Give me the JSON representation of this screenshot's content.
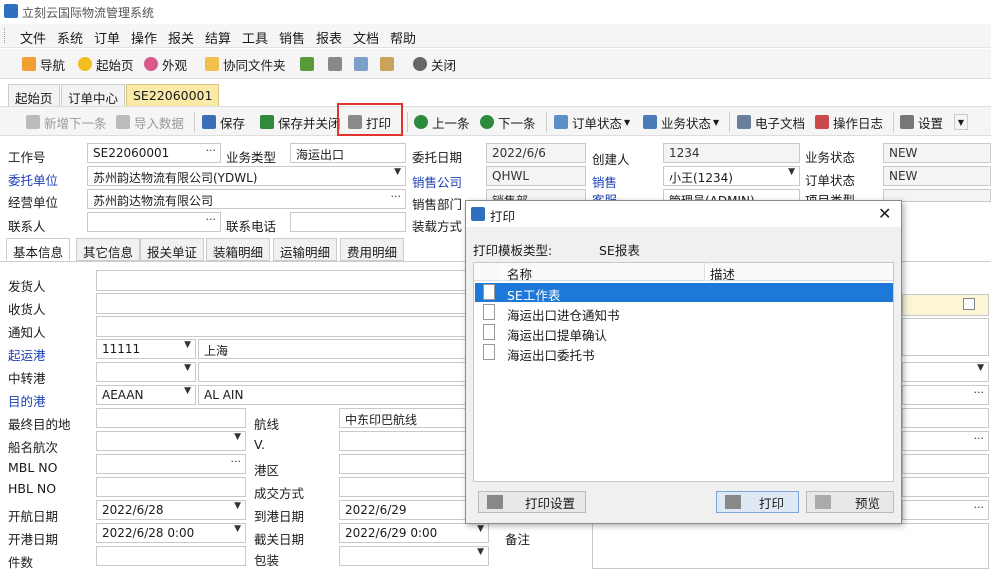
{
  "app": {
    "title": "立刻云国际物流管理系统"
  },
  "menu": [
    "文件",
    "系统",
    "订单",
    "操作",
    "报关",
    "结算",
    "工具",
    "销售",
    "报表",
    "文档",
    "帮助"
  ],
  "toolbar1": {
    "nav": "导航",
    "start": "起始页",
    "appearance": "外观",
    "collab": "协同文件夹",
    "close": "关闭"
  },
  "tabs": [
    "起始页",
    "订单中心",
    "SE22060001"
  ],
  "toolbar2": {
    "add_next": "新增下一条",
    "import": "导入数据",
    "save": "保存",
    "save_close": "保存并关闭",
    "print": "打印",
    "prev": "上一条",
    "next": "下一条",
    "order_status": "订单状态",
    "biz_status": "业务状态",
    "edoc": "电子文档",
    "oplog": "操作日志",
    "settings": "设置"
  },
  "header": {
    "job_no_label": "工作号",
    "job_no": "SE22060001",
    "biz_type_label": "业务类型",
    "biz_type": "海运出口",
    "entrust_date_label": "委托日期",
    "entrust_date": "2022/6/6",
    "creator_label": "创建人",
    "creator": "1234",
    "biz_status_label": "业务状态",
    "biz_status": "NEW",
    "client_label": "委托单位",
    "client": "苏州韵达物流有限公司(YDWL)",
    "sales_co_label": "销售公司",
    "sales_co": "QHWL",
    "sales_label": "销售",
    "sales": "小王(1234)",
    "order_status_label": "订单状态",
    "order_status": "NEW",
    "operator_unit_label": "经营单位",
    "operator_unit": "苏州韵达物流有限公司",
    "sales_dept_label": "销售部门",
    "sales_dept": "销售部",
    "cs_label": "客服",
    "cs": "管理员(ADMIN)",
    "project_type_label": "项目类型",
    "contact_label": "联系人",
    "phone_label": "联系电话",
    "load_mode_label": "装载方式"
  },
  "subtabs": [
    "基本信息",
    "其它信息",
    "报关单证",
    "装箱明细",
    "运输明细",
    "费用明细"
  ],
  "form": {
    "shipper": "发货人",
    "consignee": "收货人",
    "notify": "通知人",
    "pol_label": "起运港",
    "pol_code": "11111",
    "pol_name": "上海",
    "transit_label": "中转港",
    "pod_label": "目的港",
    "pod_code": "AEAAN",
    "pod_name": "AL AIN",
    "final_dest_label": "最终目的地",
    "route_label": "航线",
    "route": "中东印巴航线",
    "vessel_label": "船名航次",
    "v_label": "V.",
    "mbl_label": "MBL NO",
    "port_area_label": "港区",
    "hbl_label": "HBL NO",
    "deal_mode_label": "成交方式",
    "etd_label": "开航日期",
    "etd": "2022/6/28",
    "eta_label": "到港日期",
    "eta": "2022/6/29",
    "open_date_label": "开港日期",
    "open_date": "2022/6/28 0:00",
    "cutoff_label": "截关日期",
    "cutoff": "2022/6/29 0:00",
    "remark_label": "备注",
    "pieces_label": "件数",
    "pack_label": "包装"
  },
  "dialog": {
    "title": "打印",
    "template_type_label": "打印模板类型:",
    "template_type": "SE报表",
    "col_name": "名称",
    "col_desc": "描述",
    "templates": [
      "SE工作表",
      "海运出口进仓通知书",
      "海运出口提单确认",
      "海运出口委托书"
    ],
    "print_settings": "打印设置",
    "print": "打印",
    "preview": "预览"
  },
  "colors": {
    "accent": "#1e78d7",
    "highlight": "#e0342d",
    "tab_active": "#fbe9a8",
    "link_blue": "#1b3fb5"
  }
}
